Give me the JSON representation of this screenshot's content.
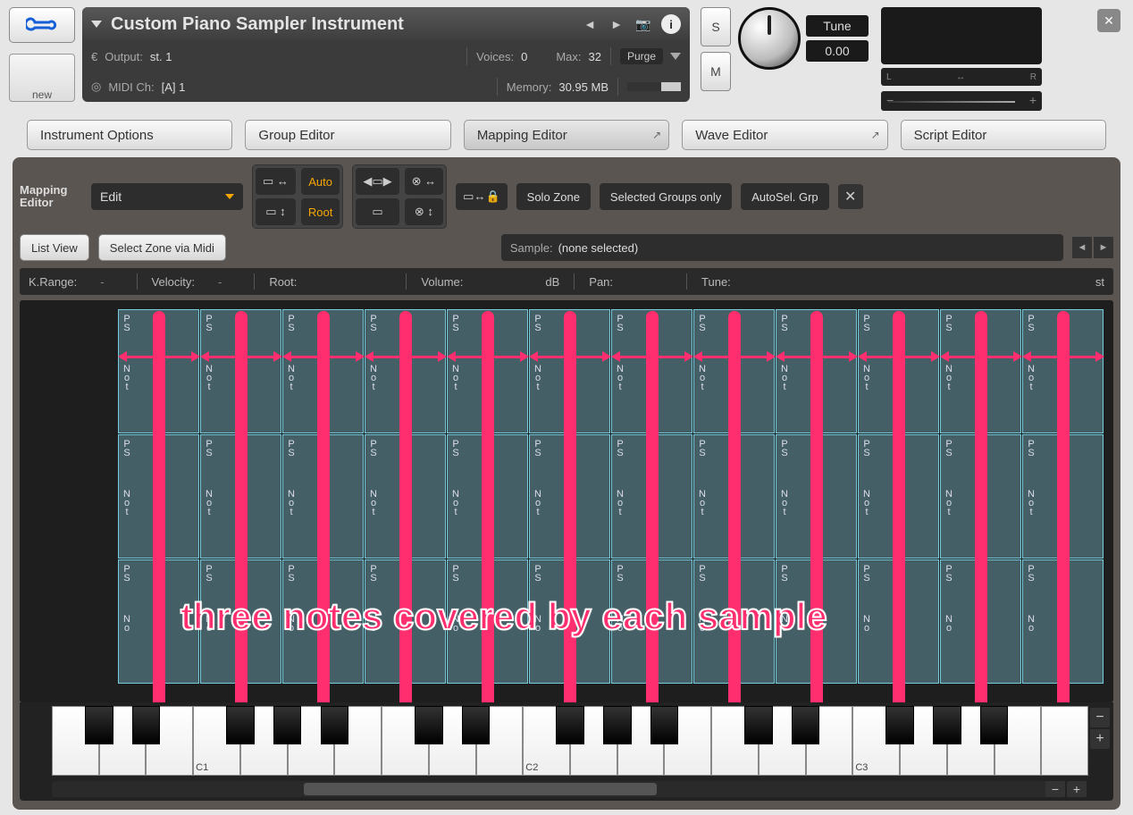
{
  "header": {
    "instrument_name": "Custom Piano Sampler Instrument",
    "output_label": "Output:",
    "output_value": "st. 1",
    "midi_label": "MIDI Ch:",
    "midi_value": "[A] 1",
    "voices_label": "Voices:",
    "voices_value": "0",
    "max_label": "Max:",
    "max_value": "32",
    "memory_label": "Memory:",
    "memory_value": "30.95 MB",
    "purge_label": "Purge",
    "tune_label": "Tune",
    "tune_value": "0.00",
    "new_label": "new",
    "s_label": "S",
    "m_label": "M",
    "pan_l": "L",
    "pan_r": "R"
  },
  "tabs": {
    "instrument_options": "Instrument Options",
    "group_editor": "Group Editor",
    "mapping_editor": "Mapping Editor",
    "wave_editor": "Wave Editor",
    "script_editor": "Script Editor"
  },
  "toolbar": {
    "title_l1": "Mapping",
    "title_l2": "Editor",
    "edit_label": "Edit",
    "auto_label": "Auto",
    "root_label": "Root",
    "list_view": "List View",
    "select_zone_midi": "Select Zone via Midi",
    "solo_zone": "Solo Zone",
    "selected_groups": "Selected Groups only",
    "autosel_grp": "AutoSel. Grp",
    "sample_label": "Sample:",
    "sample_value": "(none selected)"
  },
  "params": {
    "krange": "K.Range:",
    "velocity": "Velocity:",
    "root": "Root:",
    "volume": "Volume:",
    "db": "dB",
    "pan": "Pan:",
    "tune": "Tune:",
    "st": "st",
    "dash": "-"
  },
  "zones": {
    "abbrev_top": "PS",
    "abbrev_bot": "Not",
    "abbrev_bot_short": "No",
    "count_columns": 12,
    "rows": 3
  },
  "annotation": {
    "text": "three notes covered by each sample"
  },
  "keyboard": {
    "labels": [
      "C1",
      "C2",
      "C3"
    ]
  }
}
